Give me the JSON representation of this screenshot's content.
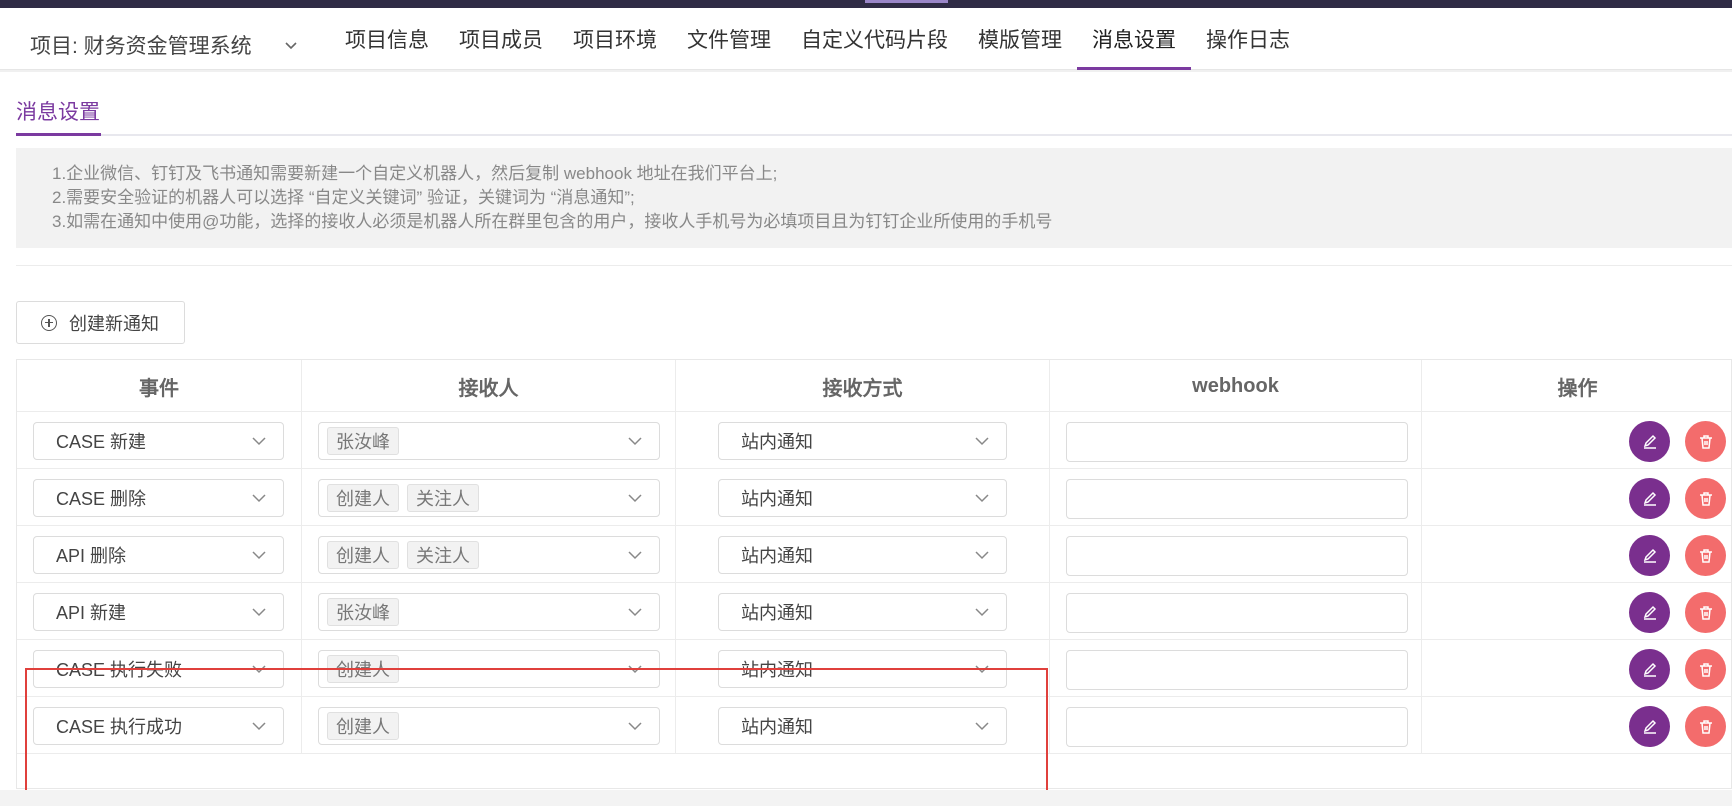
{
  "header": {
    "project_label": "项目: 财务资金管理系统",
    "tabs": [
      "项目信息",
      "项目成员",
      "项目环境",
      "文件管理",
      "自定义代码片段",
      "模版管理",
      "消息设置",
      "操作日志"
    ],
    "active_tab": "消息设置"
  },
  "subtab": {
    "label": "消息设置"
  },
  "tips": [
    "1.企业微信、钉钉及飞书通知需要新建一个自定义机器人，然后复制 webhook 地址在我们平台上;",
    "2.需要安全验证的机器人可以选择 “自定义关键词” 验证，关键词为 “消息通知”;",
    "3.如需在通知中使用@功能，选择的接收人必须是机器人所在群里包含的用户，接收人手机号为必填项目且为钉钉企业所使用的手机号"
  ],
  "create_button": {
    "label": "创建新通知"
  },
  "table": {
    "columns": [
      "事件",
      "接收人",
      "接收方式",
      "webhook",
      "操作"
    ],
    "rows": [
      {
        "event": "CASE 新建",
        "receivers": [
          "张汝峰"
        ],
        "method": "站内通知",
        "webhook": ""
      },
      {
        "event": "CASE 删除",
        "receivers": [
          "创建人",
          "关注人"
        ],
        "method": "站内通知",
        "webhook": ""
      },
      {
        "event": "API 删除",
        "receivers": [
          "创建人",
          "关注人"
        ],
        "method": "站内通知",
        "webhook": ""
      },
      {
        "event": "API 新建",
        "receivers": [
          "张汝峰"
        ],
        "method": "站内通知",
        "webhook": ""
      },
      {
        "event": "CASE 执行失败",
        "receivers": [
          "创建人"
        ],
        "method": "站内通知",
        "webhook": ""
      },
      {
        "event": "CASE 执行成功",
        "receivers": [
          "创建人"
        ],
        "method": "站内通知",
        "webhook": ""
      }
    ]
  },
  "colors": {
    "accent": "#7b3aa0",
    "edit_button": "#7a2f8e",
    "delete_button": "#f36c6c",
    "highlight_border": "#e0403c"
  },
  "icons": {
    "edit": "pencil-icon",
    "delete": "trash-icon",
    "dropdown": "chevron-down-icon",
    "create": "plus-circle-icon"
  }
}
